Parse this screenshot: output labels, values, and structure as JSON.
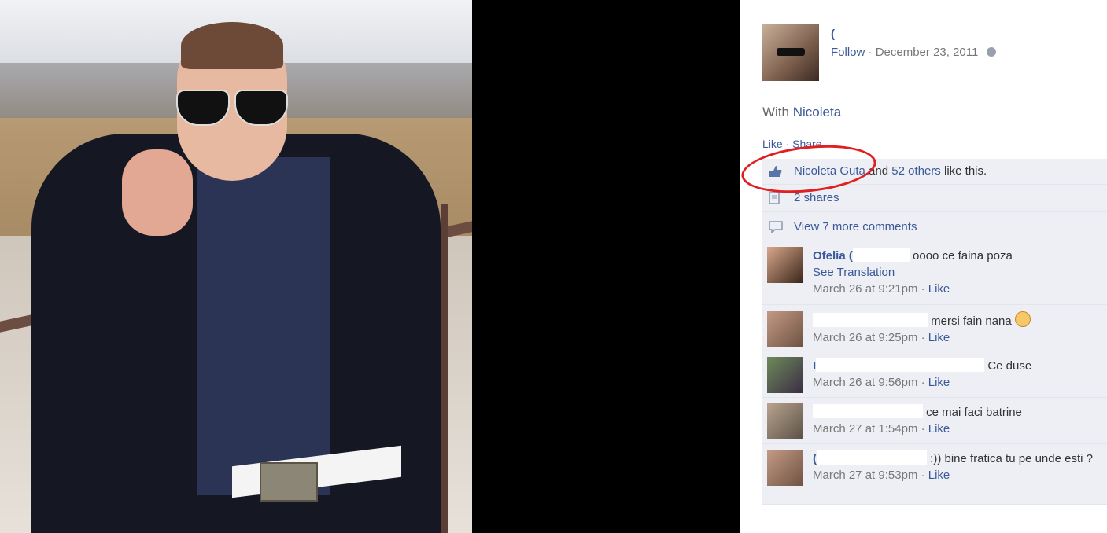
{
  "post": {
    "owner_initial": "(",
    "follow_label": "Follow",
    "separator": "·",
    "date": "December 23, 2011",
    "with_label": "With",
    "tagged_name": "Nicoleta",
    "actions": {
      "like": "Like",
      "dot": "·",
      "share": "Share"
    }
  },
  "ufi": {
    "liker_name": "Nicoleta Guta",
    "and_text": " and ",
    "others_link": "52 others",
    "like_suffix": " like this.",
    "shares": "2 shares",
    "view_more": "View 7 more comments"
  },
  "comments": [
    {
      "author": "Ofelia (",
      "text": "oooo ce faina poza",
      "see_translation": "See Translation",
      "time": "March 26 at 9:21pm",
      "like": "Like"
    },
    {
      "author": "",
      "text": "mersi fain nana",
      "time": "March 26 at 9:25pm",
      "like": "Like"
    },
    {
      "author": "I",
      "text": "Ce duse",
      "time": "March 26 at 9:56pm",
      "like": "Like"
    },
    {
      "author": "",
      "text": "ce mai faci batrine",
      "time": "March 27 at 1:54pm",
      "like": "Like"
    },
    {
      "author": "(",
      "text": ":)) bine fratica tu pe unde esti ?",
      "time": "March 27 at 9:53pm",
      "like": "Like"
    }
  ],
  "colors": {
    "link": "#3b5998",
    "ufi_bg": "#edeff4",
    "annotation": "#e02020"
  }
}
